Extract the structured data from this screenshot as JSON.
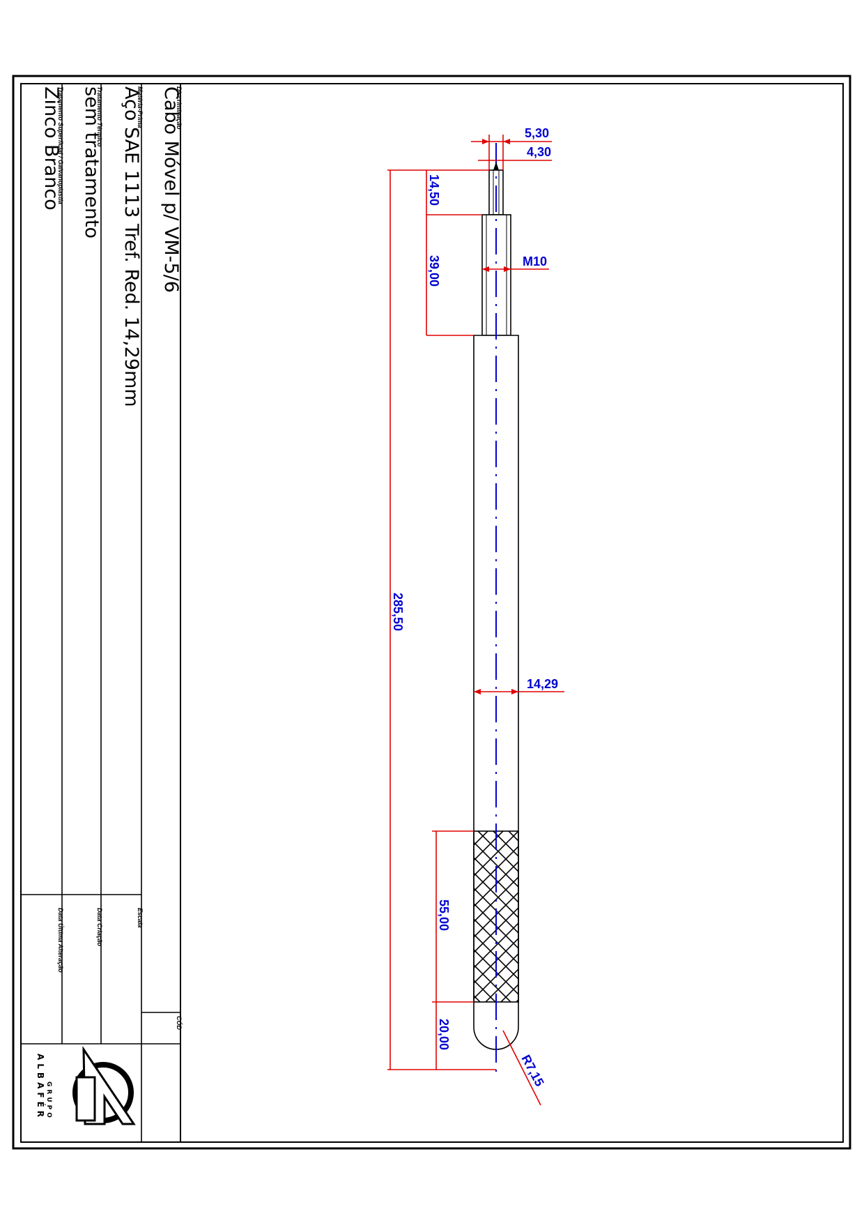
{
  "title_block": {
    "discriminacao_label": "Discriminação",
    "discriminacao_value": "Cabo Móvel p/ VM-5/6",
    "materia_prima_label": "Matéria-Prima",
    "materia_prima_value": "Aço SAE 1113 Tref. Red. 14,29mm",
    "tratamento_termico_label": "Tratamento Térmico",
    "tratamento_termico_value": "sem tratamento",
    "tratamento_superficial_label": "Tratamento Superficial / Galvanoplastia",
    "tratamento_superficial_value": "Zinco Branco",
    "escala_label": "Escala",
    "data_criacao_label": "Data Criação",
    "data_ultima_alteracao_label": "Data Última Alteração",
    "cod_label": "CÓD",
    "logo_text": "ALBAFÉR",
    "logo_subtext": "GRUPO"
  },
  "dimensions": {
    "d_5_30": "5,30",
    "d_4_30": "4,30",
    "d_m10": "M10",
    "d_14_29": "14,29",
    "d_r7_15": "R7,15",
    "d_14_50": "14,50",
    "d_39_00": "39,00",
    "d_285_50": "285,50",
    "d_55_00": "55,00",
    "d_20_00": "20,00"
  },
  "colors": {
    "dimension_lines": "#e00000",
    "dimension_text": "#0000d0",
    "outline": "#000000"
  }
}
